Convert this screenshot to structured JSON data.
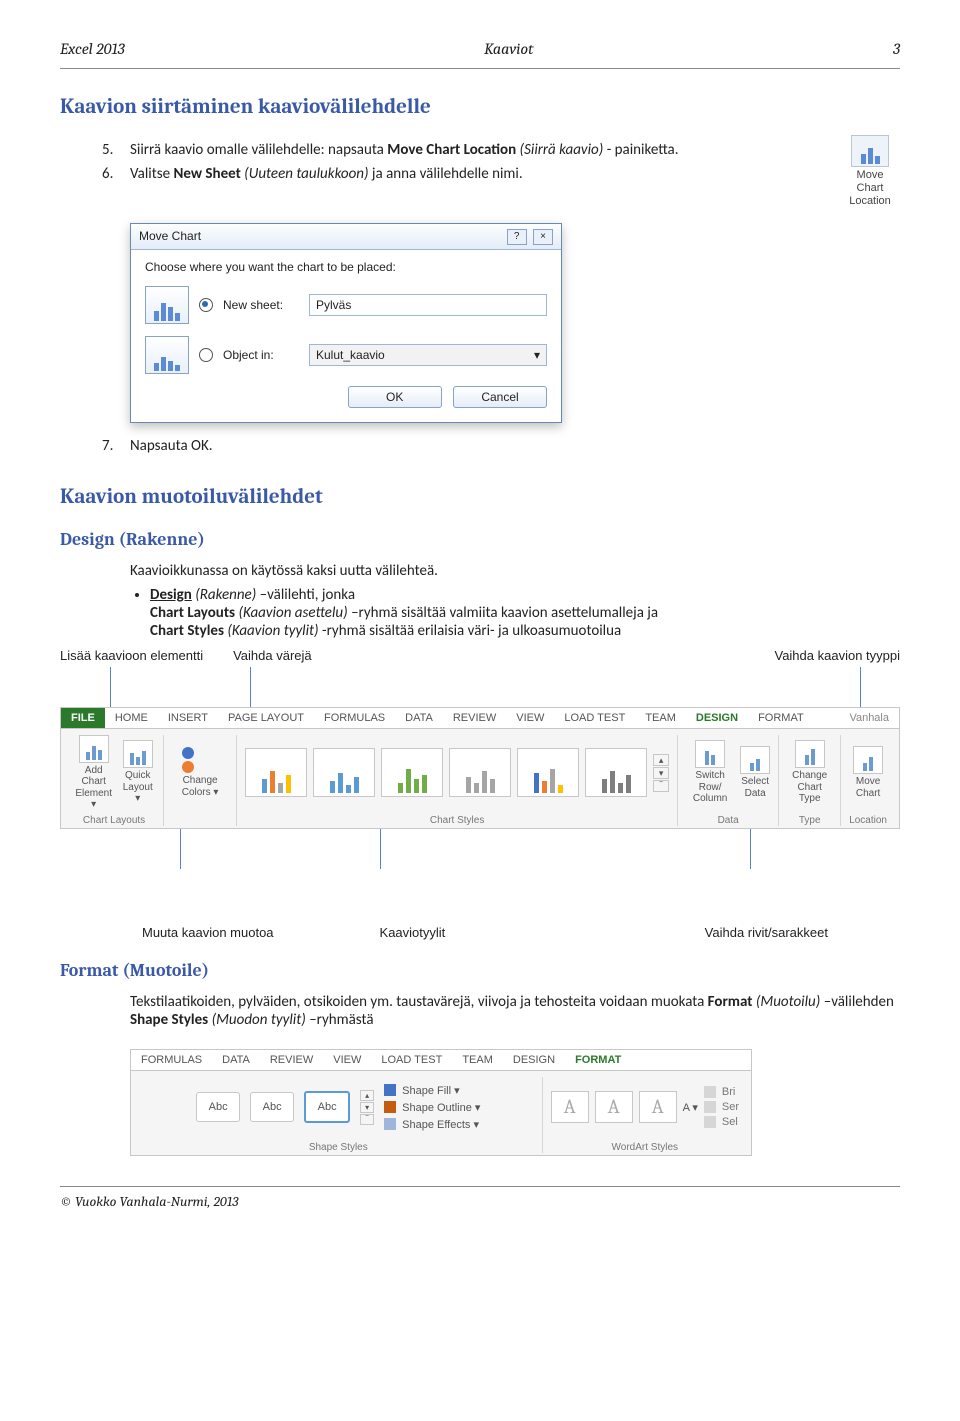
{
  "header": {
    "left": "Excel 2013",
    "center": "Kaaviot",
    "right": "3"
  },
  "section1": {
    "title": "Kaavion siirtäminen kaaviovälilehdelle",
    "items": [
      {
        "num": "5.",
        "pre": "Siirrä kaavio omalle välilehdelle: napsauta ",
        "bold": "Move Chart Location",
        "ital": " (Siirrä kaavio) ",
        "post": "- painiketta."
      },
      {
        "num": "6.",
        "pre": "Valitse ",
        "bold": "New Sheet",
        "ital": "  (Uuteen taulukkoon) ",
        "post": "ja anna välilehdelle nimi."
      }
    ],
    "item7": {
      "num": "7.",
      "text": "Napsauta OK."
    }
  },
  "moveChartBtn": {
    "l1": "Move",
    "l2": "Chart",
    "l3": "Location"
  },
  "dialog": {
    "title": "Move Chart",
    "prompt": "Choose where you want the chart to be placed:",
    "newSheet": "New sheet:",
    "newSheetVal": "Pylväs",
    "objectIn": "Object in:",
    "objectInVal": "Kulut_kaavio",
    "ok": "OK",
    "cancel": "Cancel"
  },
  "section2": {
    "title": "Kaavion muotoiluvälilehdet",
    "sub": "Design (Rakenne)",
    "p1": "Kaavioikkunassa on käytössä kaksi uutta välilehteä.",
    "b1a": "Design",
    "b1ital": " (Rakenne)",
    "b1b": " –välilehti, jonka",
    "b2a": "Chart Layouts",
    "b2ital": " (Kaavion asettelu)",
    "b2b": " –ryhmä sisältää valmiita kaavion asettelumalleja ja",
    "b3a": "Chart Styles",
    "b3ital": " (Kaavion tyylit)",
    "b3b": "  -ryhmä  sisältää erilaisia väri- ja ulkoasumuotoilua"
  },
  "annotTop": {
    "a": "Lisää kaavioon elementti",
    "b": "Vaihda värejä",
    "c": "Vaihda kaavion tyyppi"
  },
  "ribbon1": {
    "tabs": [
      "FILE",
      "HOME",
      "INSERT",
      "PAGE LAYOUT",
      "FORMULAS",
      "DATA",
      "REVIEW",
      "VIEW",
      "LOAD TEST",
      "TEAM",
      "DESIGN",
      "FORMAT"
    ],
    "right": "Vanhala",
    "g_layouts": "Chart Layouts",
    "g_styles": "Chart Styles",
    "g_data": "Data",
    "g_type": "Type",
    "g_loc": "Location",
    "addEl": "Add Chart\nElement ▾",
    "quick": "Quick\nLayout ▾",
    "colors": "Change\nColors ▾",
    "switch": "Switch Row/\nColumn",
    "select": "Select\nData",
    "change": "Change\nChart Type",
    "move": "Move\nChart"
  },
  "callouts": {
    "a": "Muuta kaavion muotoa",
    "b": "Kaaviotyylit",
    "c": "Vaihda rivit/sarakkeet"
  },
  "section3": {
    "title": "Format (Muotoile)",
    "p_pre": "Tekstilaatikoiden, pylväiden, otsikoiden ym. taustavärejä, viivoja ja tehosteita voidaan muokata ",
    "b1": "Format",
    "i1": " (Muotoilu)",
    "mid": " –välilehden ",
    "b2": "Shape Styles",
    "i2": " (Muodon tyylit)",
    "post": " –ryhmästä"
  },
  "ribbon2": {
    "tabs": [
      "FORMULAS",
      "DATA",
      "REVIEW",
      "VIEW",
      "LOAD TEST",
      "TEAM",
      "DESIGN",
      "FORMAT"
    ],
    "g_shape": "Shape Styles",
    "g_wa": "WordArt Styles",
    "fill": "Shape Fill ▾",
    "outline": "Shape Outline ▾",
    "effects": "Shape Effects ▾",
    "wa_a": "A ▾",
    "wa_b": "Bri",
    "wa_c": "Ser",
    "wa_d": "Sel"
  },
  "footer": "© Vuokko Vanhala-Nurmi, 2013"
}
